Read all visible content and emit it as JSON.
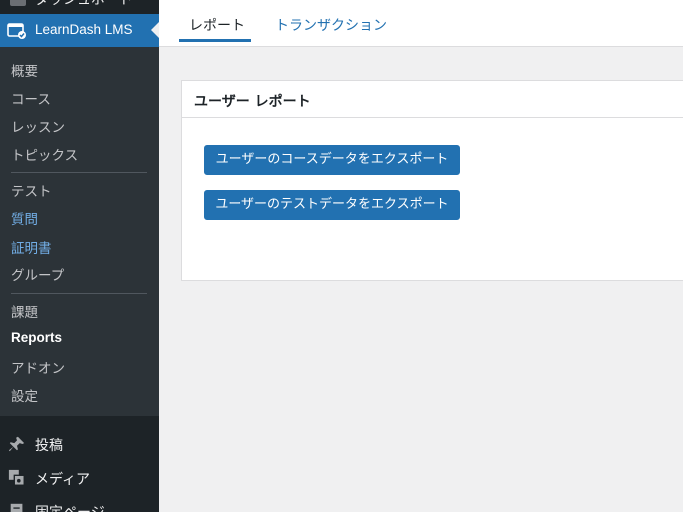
{
  "sidebar": {
    "top_item_label": "ダッシュボード",
    "current_menu": {
      "label": "LearnDash LMS",
      "icon": "learndash-icon"
    },
    "submenu": [
      {
        "label": "概要",
        "style": "normal"
      },
      {
        "label": "コース",
        "style": "normal"
      },
      {
        "label": "レッスン",
        "style": "normal"
      },
      {
        "label": "トピックス",
        "style": "normal"
      },
      {
        "label": "テスト",
        "style": "normal"
      },
      {
        "label": "質問",
        "style": "blue"
      },
      {
        "label": "証明書",
        "style": "blue"
      },
      {
        "label": "グループ",
        "style": "normal"
      },
      {
        "label": "課題",
        "style": "normal"
      },
      {
        "label": "Reports",
        "style": "current"
      },
      {
        "label": "アドオン",
        "style": "normal"
      },
      {
        "label": "設定",
        "style": "normal"
      }
    ],
    "menu": [
      {
        "label": "投稿",
        "icon": "pushpin-icon"
      },
      {
        "label": "メディア",
        "icon": "media-icon"
      },
      {
        "label": "固定ページ",
        "icon": "page-icon"
      }
    ]
  },
  "tabs": [
    {
      "label": "レポート",
      "active": true
    },
    {
      "label": "トランザクション",
      "active": false
    }
  ],
  "card": {
    "title": "ユーザー レポート",
    "buttons": [
      "ユーザーのコースデータをエクスポート",
      "ユーザーのテストデータをエクスポート"
    ]
  },
  "colors": {
    "sidebar_bg": "#1d2327",
    "submenu_bg": "#2c3338",
    "accent": "#2271b1",
    "link_blue": "#72aee6",
    "page_bg": "#f0f0f1"
  }
}
